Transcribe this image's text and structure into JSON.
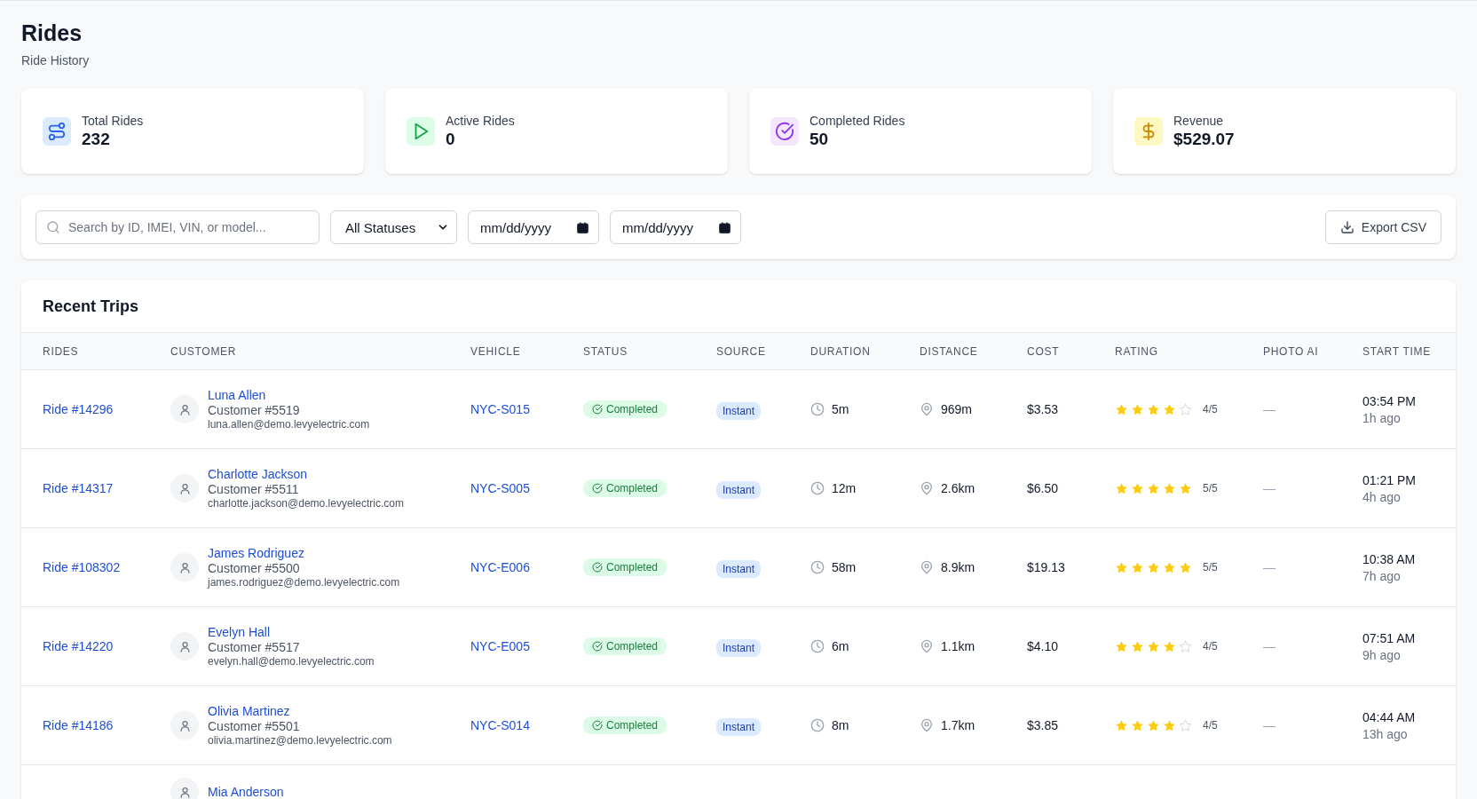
{
  "header": {
    "title": "Rides",
    "subtitle": "Ride History"
  },
  "stats": [
    {
      "kind": "routes",
      "label": "Total Rides",
      "value": "232"
    },
    {
      "kind": "play",
      "label": "Active Rides",
      "value": "0"
    },
    {
      "kind": "check",
      "label": "Completed Rides",
      "value": "50"
    },
    {
      "kind": "dollar",
      "label": "Revenue",
      "value": "$529.07"
    }
  ],
  "filters": {
    "search": {
      "placeholder": "Search by ID, IMEI, VIN, or model..."
    },
    "status": "All Statuses",
    "date_from": "mm/dd/yyyy",
    "date_to": "mm/dd/yyyy",
    "export": "Export CSV"
  },
  "table": {
    "title": "Recent Trips",
    "columns": [
      "RIDES",
      "CUSTOMER",
      "VEHICLE",
      "STATUS",
      "SOURCE",
      "DURATION",
      "DISTANCE",
      "COST",
      "RATING",
      "PHOTO AI",
      "START TIME"
    ],
    "rows": [
      {
        "ride": "Ride #14296",
        "name": "Luna Allen",
        "customer": "Customer #5519",
        "email": "luna.allen@demo.levyelectric.com",
        "vehicle": "NYC-S015",
        "status": "Completed",
        "source": "Instant",
        "duration": "5m",
        "distance": "969m",
        "cost": "$3.53",
        "stars": 4,
        "rating": "4/5",
        "photo_ai": "—",
        "time": "03:54 PM",
        "ago": "1h ago"
      },
      {
        "ride": "Ride #14317",
        "name": "Charlotte Jackson",
        "customer": "Customer #5511",
        "email": "charlotte.jackson@demo.levyelectric.com",
        "vehicle": "NYC-S005",
        "status": "Completed",
        "source": "Instant",
        "duration": "12m",
        "distance": "2.6km",
        "cost": "$6.50",
        "stars": 5,
        "rating": "5/5",
        "photo_ai": "—",
        "time": "01:21 PM",
        "ago": "4h ago"
      },
      {
        "ride": "Ride #108302",
        "name": "James Rodriguez",
        "customer": "Customer #5500",
        "email": "james.rodriguez@demo.levyelectric.com",
        "vehicle": "NYC-E006",
        "status": "Completed",
        "source": "Instant",
        "duration": "58m",
        "distance": "8.9km",
        "cost": "$19.13",
        "stars": 5,
        "rating": "5/5",
        "photo_ai": "—",
        "time": "10:38 AM",
        "ago": "7h ago"
      },
      {
        "ride": "Ride #14220",
        "name": "Evelyn Hall",
        "customer": "Customer #5517",
        "email": "evelyn.hall@demo.levyelectric.com",
        "vehicle": "NYC-E005",
        "status": "Completed",
        "source": "Instant",
        "duration": "6m",
        "distance": "1.1km",
        "cost": "$4.10",
        "stars": 4,
        "rating": "4/5",
        "photo_ai": "—",
        "time": "07:51 AM",
        "ago": "9h ago"
      },
      {
        "ride": "Ride #14186",
        "name": "Olivia Martinez",
        "customer": "Customer #5501",
        "email": "olivia.martinez@demo.levyelectric.com",
        "vehicle": "NYC-S014",
        "status": "Completed",
        "source": "Instant",
        "duration": "8m",
        "distance": "1.7km",
        "cost": "$3.85",
        "stars": 4,
        "rating": "4/5",
        "photo_ai": "—",
        "time": "04:44 AM",
        "ago": "13h ago"
      },
      {
        "name": "Mia Anderson"
      }
    ]
  }
}
